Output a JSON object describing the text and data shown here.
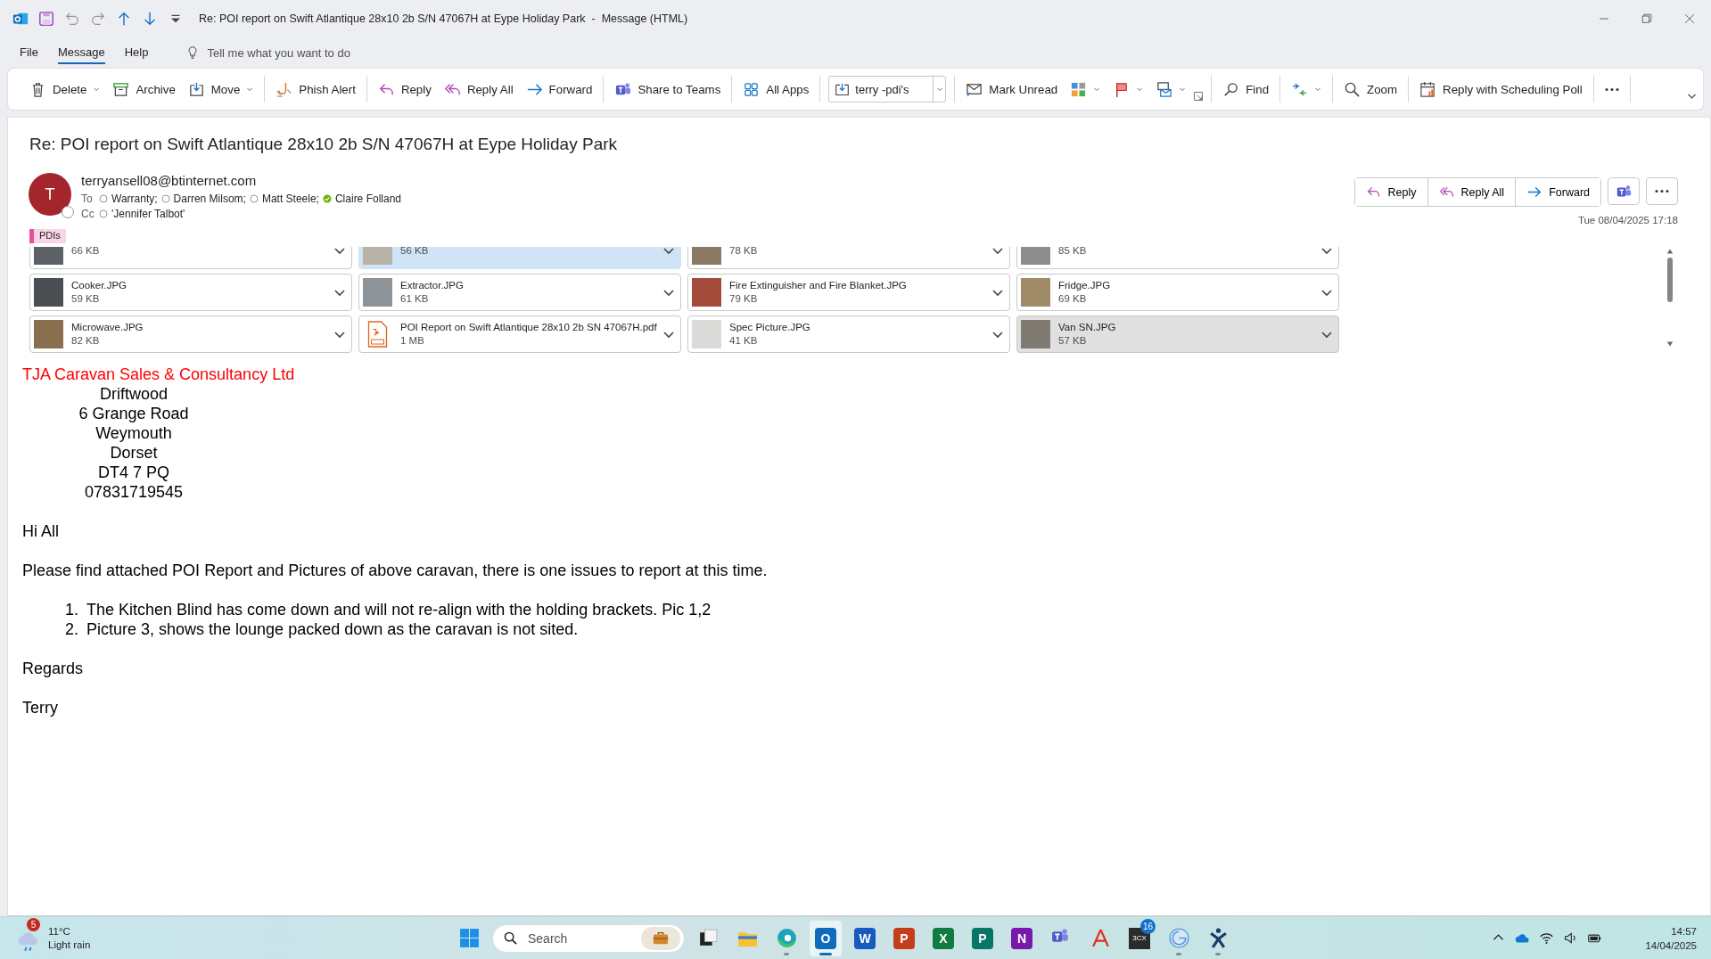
{
  "window": {
    "title": "Re: POI report on Swift Atlantique 28x10 2b S/N 47067H at Eype Holiday Park  -  Message (HTML)"
  },
  "menu_tabs": [
    {
      "label": "File",
      "selected": false
    },
    {
      "label": "Message",
      "selected": true
    },
    {
      "label": "Help",
      "selected": false
    }
  ],
  "tell_me": {
    "placeholder": "Tell me what you want to do"
  },
  "ribbon": {
    "groups": [
      {
        "items": [
          {
            "kind": "split",
            "label": "Delete"
          },
          {
            "kind": "button",
            "label": "Archive"
          },
          {
            "kind": "menu",
            "label": "Move"
          }
        ]
      },
      {
        "items": [
          {
            "kind": "button",
            "label": "Phish Alert"
          }
        ]
      },
      {
        "items": [
          {
            "kind": "button",
            "label": "Reply"
          },
          {
            "kind": "button",
            "label": "Reply All"
          },
          {
            "kind": "button",
            "label": "Forward"
          }
        ]
      },
      {
        "items": [
          {
            "kind": "button",
            "label": "Share to Teams"
          }
        ]
      },
      {
        "items": [
          {
            "kind": "button",
            "label": "All Apps"
          }
        ]
      },
      {
        "items": [
          {
            "kind": "combo",
            "value": "terry -pdi's"
          }
        ]
      },
      {
        "items": [
          {
            "kind": "button",
            "label": "Mark Unread"
          },
          {
            "kind": "icon_menu"
          },
          {
            "kind": "icon_menu"
          },
          {
            "kind": "icon_menu"
          },
          {
            "kind": "launcher"
          }
        ]
      },
      {
        "items": [
          {
            "kind": "button",
            "label": "Find"
          }
        ]
      },
      {
        "items": [
          {
            "kind": "icon_menu"
          }
        ]
      },
      {
        "items": [
          {
            "kind": "button",
            "label": "Zoom"
          }
        ]
      },
      {
        "items": [
          {
            "kind": "button",
            "label": "Reply with Scheduling Poll"
          }
        ]
      },
      {
        "items": [
          {
            "kind": "more"
          }
        ]
      }
    ]
  },
  "message": {
    "subject": "Re: POI report on Swift Atlantique 28x10 2b S/N 47067H at Eype Holiday Park",
    "avatar_initial": "T",
    "sender": "terryansell08@btinternet.com",
    "to_label": "To",
    "to": [
      {
        "name": "Warranty;",
        "available": false
      },
      {
        "name": "Darren Milsom;",
        "available": false
      },
      {
        "name": "Matt Steele;",
        "available": false
      },
      {
        "name": "Claire Folland",
        "available": true
      }
    ],
    "cc_label": "Cc",
    "cc": [
      {
        "name": "'Jennifer Talbot'",
        "available": false
      }
    ],
    "category": {
      "label": "PDIs",
      "color": "#e8509c"
    },
    "actions": [
      {
        "label": "Reply"
      },
      {
        "label": "Reply All"
      },
      {
        "label": "Forward"
      }
    ],
    "date": "Tue 08/04/2025 17:18"
  },
  "attachments": [
    {
      "kind": "image",
      "size": "66 KB",
      "selected": false,
      "hovered": false
    },
    {
      "kind": "image",
      "size": "56 KB",
      "selected": true,
      "hovered": false
    },
    {
      "kind": "image",
      "size": "78 KB",
      "selected": false,
      "hovered": false
    },
    {
      "kind": "image",
      "size": "85 KB",
      "selected": false,
      "hovered": false
    },
    {
      "kind": "image",
      "name": "Cooker.JPG",
      "size": "59 KB",
      "selected": false,
      "hovered": false
    },
    {
      "kind": "image",
      "name": "Extractor.JPG",
      "size": "61 KB",
      "selected": false,
      "hovered": false
    },
    {
      "kind": "image",
      "name": "Fire Extinguisher and Fire Blanket.JPG",
      "size": "79 KB",
      "selected": false,
      "hovered": false
    },
    {
      "kind": "image",
      "name": "Fridge.JPG",
      "size": "69 KB",
      "selected": false,
      "hovered": false
    },
    {
      "kind": "image",
      "name": "Microwave.JPG",
      "size": "82 KB",
      "selected": false,
      "hovered": false
    },
    {
      "kind": "pdf",
      "name": "POI Report on Swift Atlantique 28x10 2b SN 47067H.pdf",
      "size": "1 MB",
      "selected": false,
      "hovered": false
    },
    {
      "kind": "image",
      "name": "Spec Picture.JPG",
      "size": "41 KB",
      "selected": false,
      "hovered": false
    },
    {
      "kind": "image",
      "name": "Van SN.JPG",
      "size": "57 KB",
      "selected": false,
      "hovered": true
    }
  ],
  "body": {
    "company": "TJA Caravan Sales & Consultancy Ltd",
    "address": [
      "Driftwood",
      "6 Grange Road",
      "Weymouth",
      "Dorset",
      "DT4 7 PQ",
      "07831719545"
    ],
    "greeting": "Hi All",
    "intro": "Please find attached POI Report and Pictures of above caravan, there is one issues to report at this time.",
    "list": [
      {
        "number": "1.",
        "text": "The Kitchen Blind has come down and will not re-align with the holding brackets. Pic 1,2"
      },
      {
        "number": "2.",
        "text": "Picture 3, shows the lounge packed down as the caravan is not sited."
      }
    ],
    "closing": "Regards",
    "signature": "Terry"
  },
  "taskbar": {
    "weather": {
      "temperature": "11°C",
      "condition": "Light rain",
      "badge": "5"
    },
    "search": {
      "placeholder": "Search"
    },
    "apps": [
      {
        "kind": "start",
        "running": false,
        "selected": false
      },
      {
        "kind": "search"
      },
      {
        "kind": "taskview",
        "running": false,
        "selected": false
      },
      {
        "kind": "explorer",
        "running": false,
        "selected": false
      },
      {
        "kind": "edge",
        "running": true,
        "selected": false
      },
      {
        "kind": "office",
        "label": "O",
        "color": "#0f6cbd",
        "running": true,
        "selected": true
      },
      {
        "kind": "office",
        "label": "W",
        "color": "#185abd",
        "running": false,
        "selected": false
      },
      {
        "kind": "office",
        "label": "P",
        "color": "#c43e1c",
        "running": false,
        "selected": false
      },
      {
        "kind": "office",
        "label": "X",
        "color": "#107c41",
        "running": false,
        "selected": false
      },
      {
        "kind": "office",
        "label": "P",
        "color": "#077568",
        "running": false,
        "selected": false
      },
      {
        "kind": "office",
        "label": "N",
        "color": "#7719aa",
        "running": false,
        "selected": false
      },
      {
        "kind": "teams",
        "running": false,
        "selected": false
      },
      {
        "kind": "acrobat",
        "running": false,
        "selected": false
      },
      {
        "kind": "badge_app",
        "label": "3CX",
        "badge": "16",
        "running": false,
        "selected": false
      },
      {
        "kind": "globe",
        "running": true,
        "selected": false
      },
      {
        "kind": "figure",
        "running": true,
        "selected": false
      }
    ],
    "time": "14:57",
    "date": "14/04/2025"
  }
}
